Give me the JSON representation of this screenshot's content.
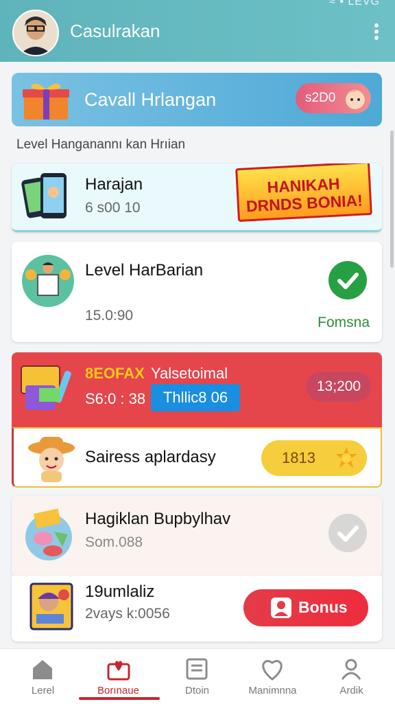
{
  "status_bar": {
    "text": "≈ ▪ LEVG"
  },
  "header": {
    "title": "Casulrakan"
  },
  "banner": {
    "title": "Cavall Hrlangan",
    "pill": "s2D0"
  },
  "section_label": "Level Hanganannı kan Hrıian",
  "cards": [
    {
      "title": "Harajan",
      "sub": "6 s00 10",
      "promo": "HANIKAH DRNDS BONIA!"
    },
    {
      "title": "Level HarBarian",
      "sub": "15.0:90",
      "status": "Fomsna"
    },
    {
      "tag": "8EOFAX",
      "label": "Yalsetoimal",
      "timer": "S6:0 : 38",
      "blue_tag": "Thllic8 06",
      "pill": "13;200"
    },
    {
      "title": "Sairess aplardasy",
      "pill": "1813"
    },
    {
      "title": "Hagiklan Bupbylhav",
      "sub": "Som.088"
    },
    {
      "title": "19umlaliz",
      "sub": "2vays k:0056",
      "button": "Bonus"
    }
  ],
  "nav": [
    {
      "label": "Lerel"
    },
    {
      "label": "Borınaue"
    },
    {
      "label": "Dtoin"
    },
    {
      "label": "Manimnna"
    },
    {
      "label": "Ardik"
    }
  ],
  "colors": {
    "header": "#5fb3ba",
    "accent_red": "#e4464c",
    "active_nav": "#c2242a",
    "green": "#27a043"
  }
}
